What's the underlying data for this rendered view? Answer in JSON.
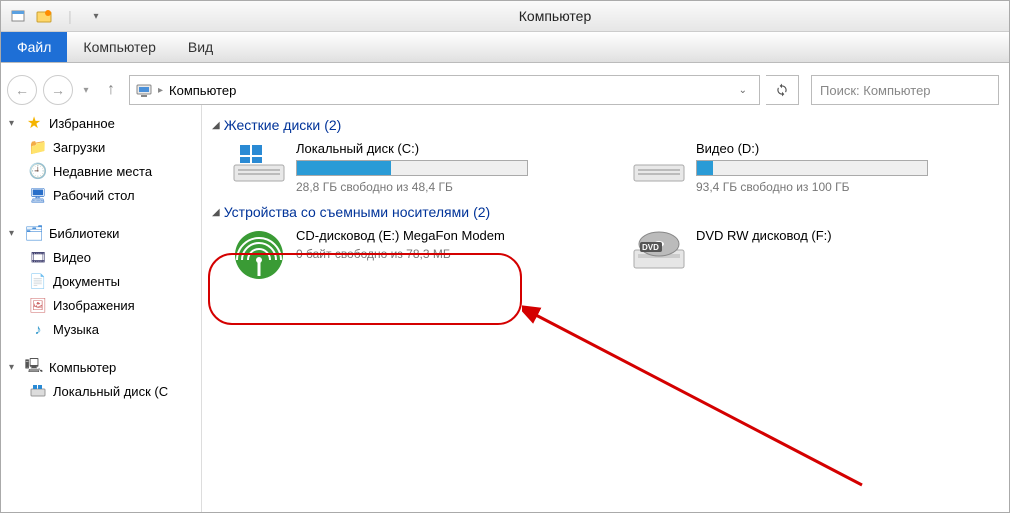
{
  "window": {
    "title": "Компьютер"
  },
  "ribbon": {
    "file": "Файл",
    "computer": "Компьютер",
    "view": "Вид"
  },
  "address": {
    "location": "Компьютер"
  },
  "search": {
    "placeholder": "Поиск: Компьютер"
  },
  "sidebar": {
    "favorites": {
      "label": "Избранное",
      "items": [
        "Загрузки",
        "Недавние места",
        "Рабочий стол"
      ]
    },
    "libraries": {
      "label": "Библиотеки",
      "items": [
        "Видео",
        "Документы",
        "Изображения",
        "Музыка"
      ]
    },
    "computer": {
      "label": "Компьютер",
      "items": [
        "Локальный диск (C"
      ]
    }
  },
  "sections": [
    {
      "title": "Жесткие диски",
      "count": "(2)",
      "items": [
        {
          "name": "Локальный диск (C:)",
          "free": "28,8 ГБ свободно из 48,4 ГБ",
          "used_pct": 41
        },
        {
          "name": "Видео (D:)",
          "free": "93,4 ГБ свободно из 100 ГБ",
          "used_pct": 7
        }
      ]
    },
    {
      "title": "Устройства со съемными носителями",
      "count": "(2)",
      "items": [
        {
          "name": "CD-дисковод (E:) MegaFon Modem",
          "free": "0 байт свободно из 78,3 МБ"
        },
        {
          "name": "DVD RW дисковод (F:)"
        }
      ]
    }
  ]
}
